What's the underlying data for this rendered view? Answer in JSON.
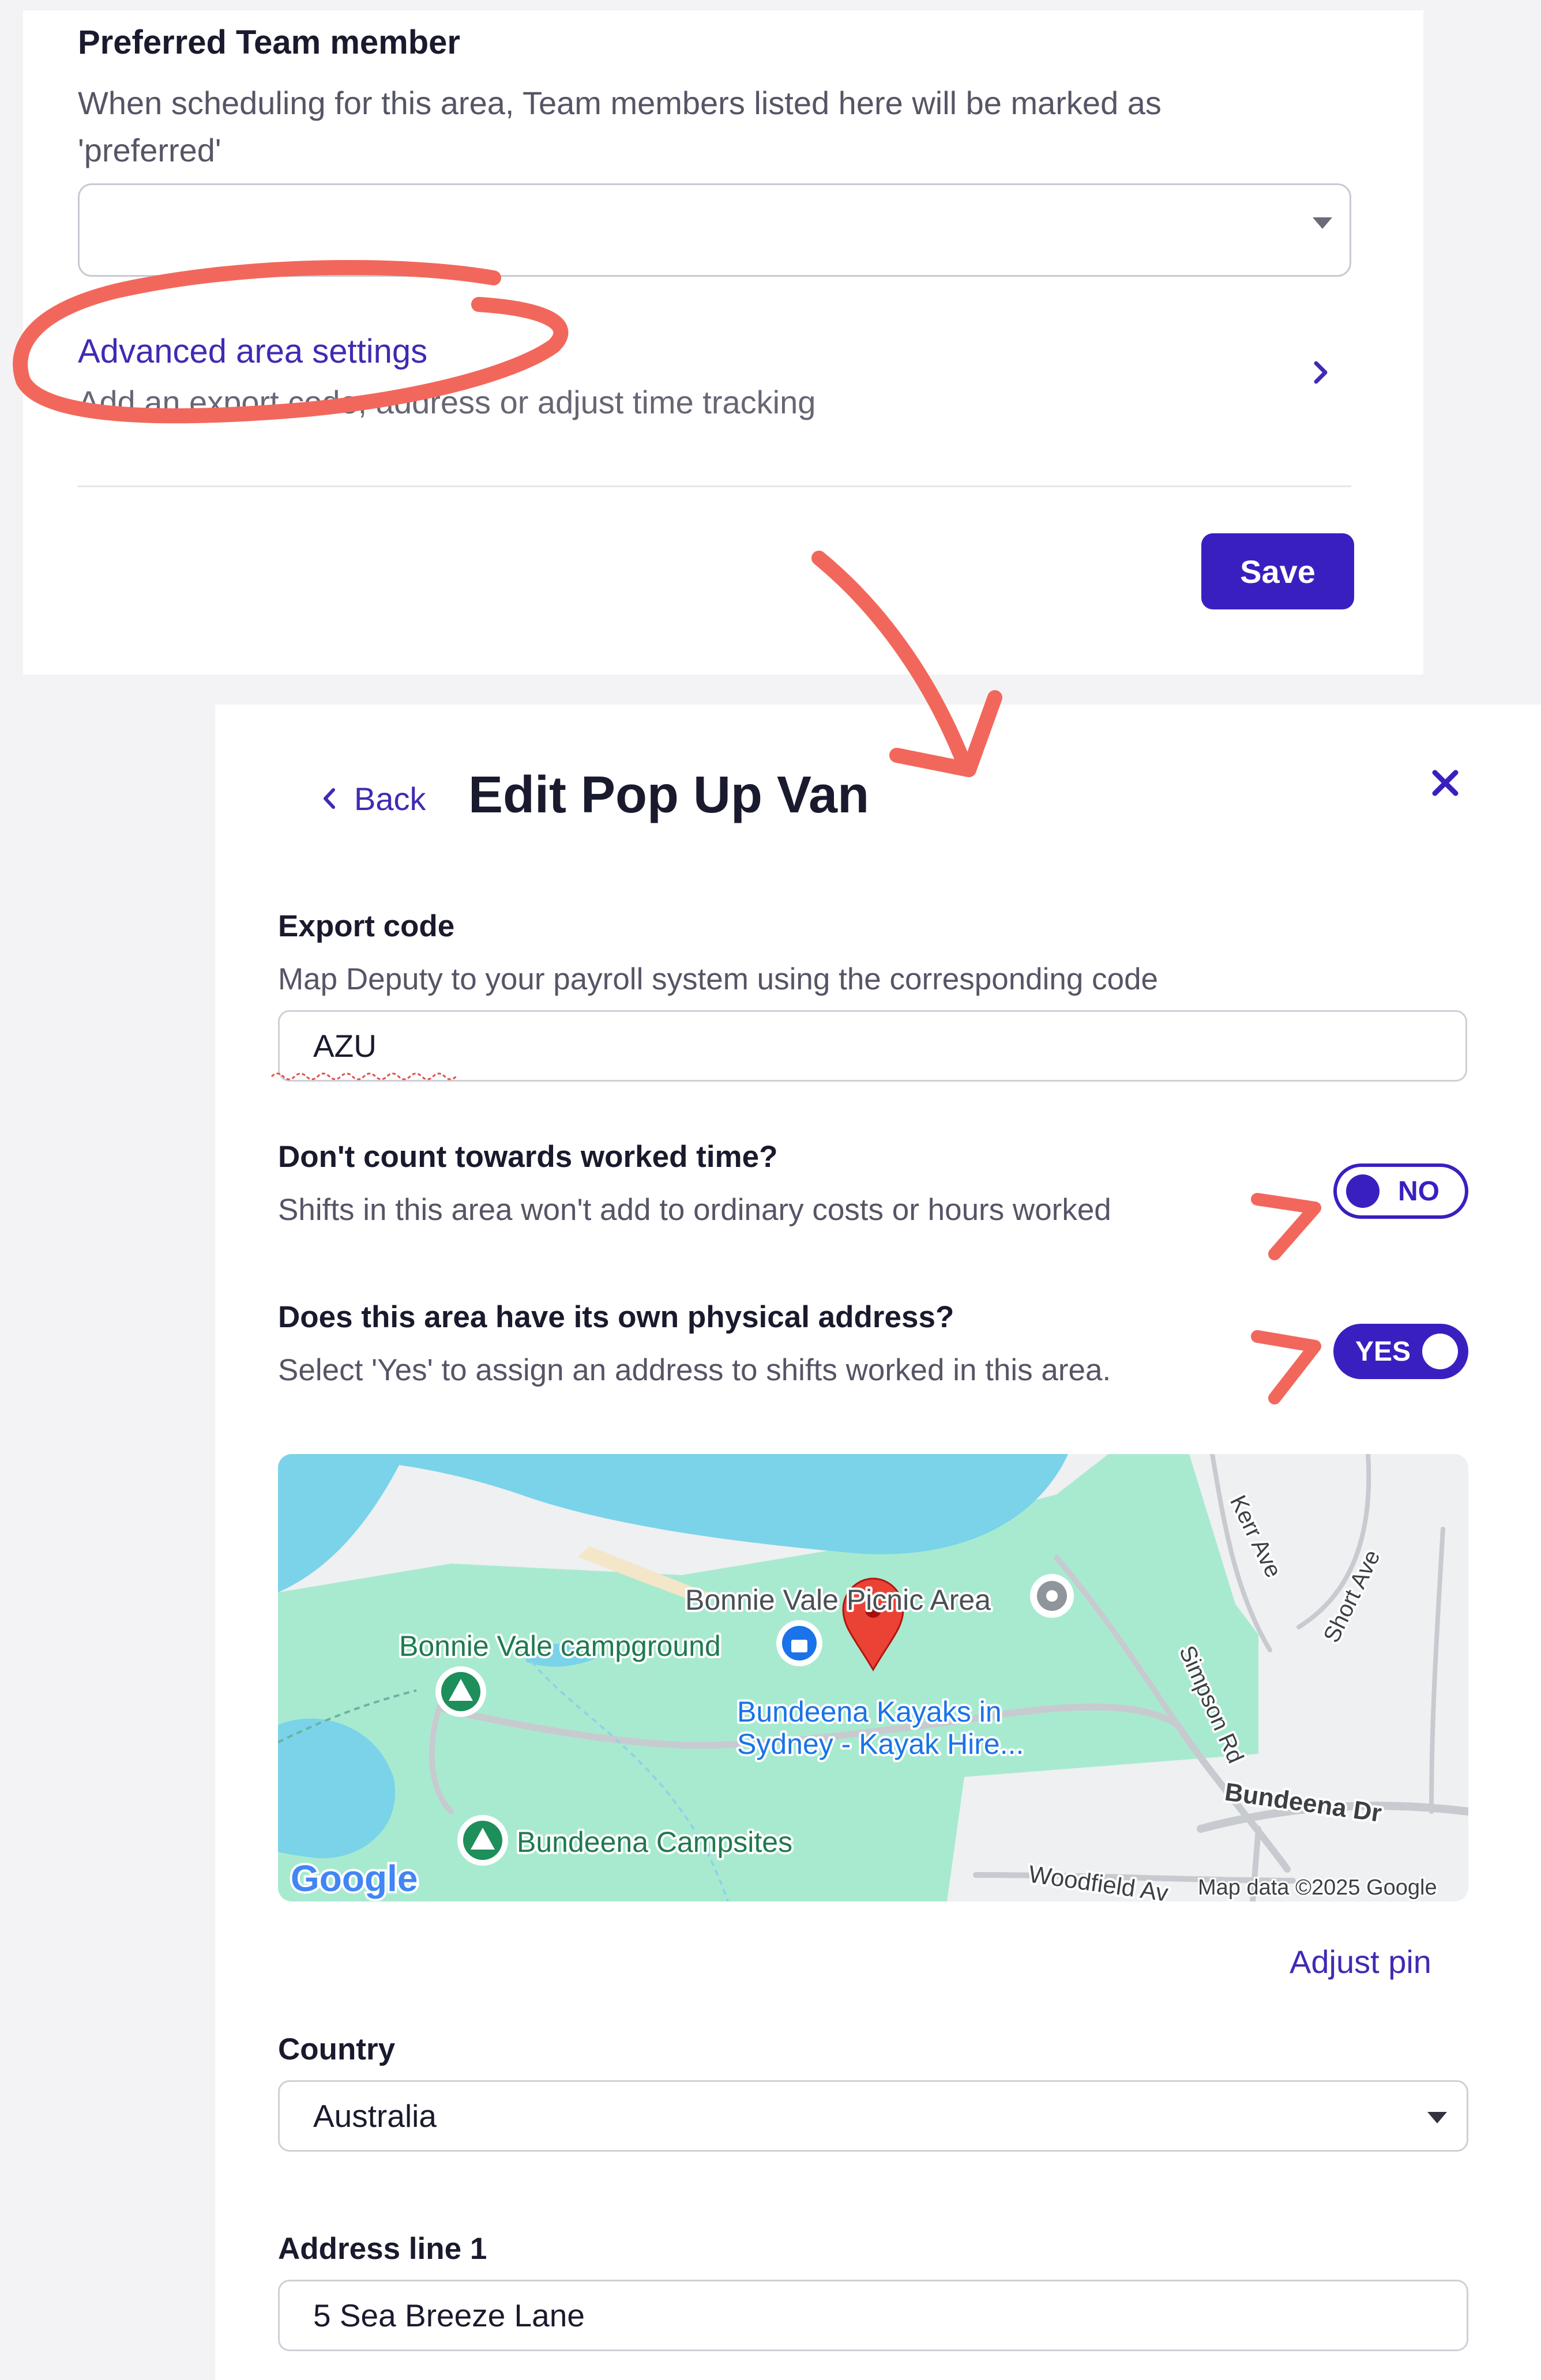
{
  "top_panel": {
    "preferred_title": "Preferred Team member",
    "preferred_desc": "When scheduling for this area, Team members listed here will be marked as 'preferred'",
    "advanced_link": "Advanced area settings",
    "advanced_sub": "Add an export code, address or adjust time tracking",
    "save_label": "Save"
  },
  "drawer": {
    "back_label": "Back",
    "title": "Edit Pop Up Van",
    "export": {
      "label": "Export code",
      "desc": "Map Deputy to your payroll system using the corresponding code",
      "value": "AZU"
    },
    "worked_time": {
      "label": "Don't count towards worked time?",
      "desc": "Shifts in this area won't add to ordinary costs or hours worked",
      "toggle_label": "NO"
    },
    "physical_address": {
      "label": "Does this area have its own physical address?",
      "desc": "Select 'Yes' to assign an address to shifts worked in this area.",
      "toggle_label": "YES"
    },
    "map": {
      "labels": {
        "picnic": "Bonnie Vale Picnic Area",
        "campground": "Bonnie Vale campground",
        "kayak_1": "Bundeena Kayaks in",
        "kayak_2": "Sydney - Kayak Hire...",
        "campsites": "Bundeena Campsites",
        "kerr": "Kerr Ave",
        "short": "Short Ave",
        "simpson": "Simpson Rd",
        "bundeena_dr": "Bundeena Dr",
        "woodfield": "Woodfield Av",
        "attribution": "Map data ©2025 Google",
        "google": "Google"
      }
    },
    "adjust_pin": "Adjust pin",
    "country": {
      "label": "Country",
      "value": "Australia"
    },
    "address_line1": {
      "label": "Address line 1",
      "value": "5 Sea Breeze Lane"
    }
  },
  "colors": {
    "accent": "#3a1fc0",
    "link": "#3f2bb3",
    "annotation": "#f2675c",
    "water": "#7ad3e9",
    "park": "#a8ead0"
  }
}
